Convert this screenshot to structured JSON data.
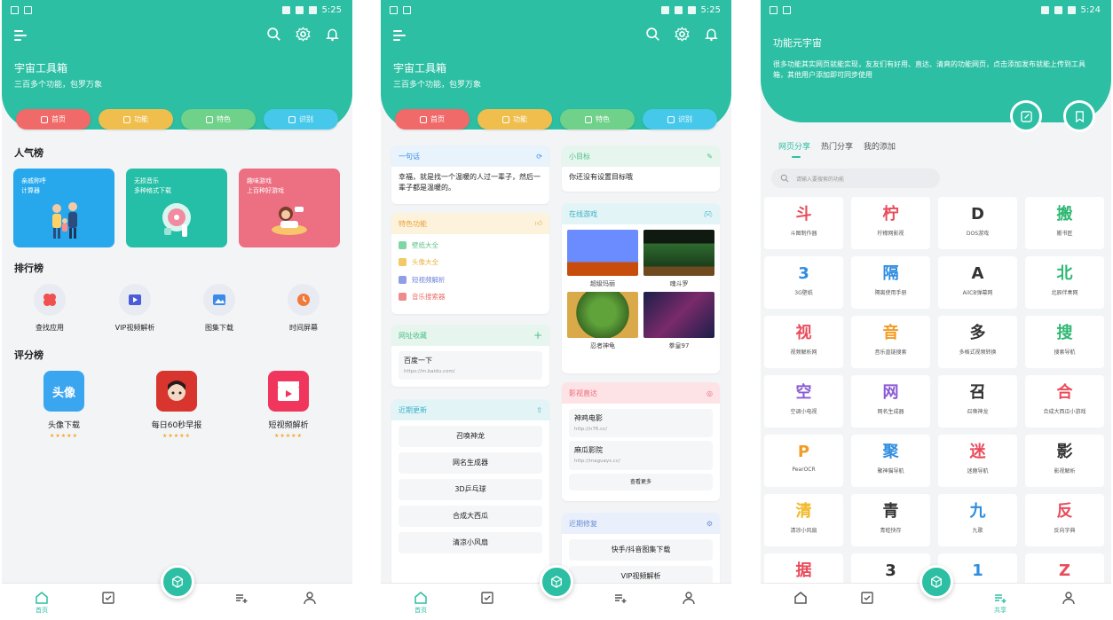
{
  "status_times": [
    "5:25",
    "5:25",
    "5:24"
  ],
  "header": {
    "title": "宇宙工具箱",
    "subtitle": "三百多个功能，包罗万象"
  },
  "pills": [
    "首页",
    "功能",
    "特色",
    "识别"
  ],
  "screen1": {
    "popular_title": "人气榜",
    "banners": [
      {
        "line1": "亲戚称呼",
        "line2": "计算器",
        "color": "#27a8ec"
      },
      {
        "line1": "无损音乐",
        "line2": "多种格式下载",
        "color": "#24bfa6"
      },
      {
        "line1": "趣味游戏",
        "line2": "上百种好游戏",
        "color": "#ec6f82"
      }
    ],
    "ranking_title": "排行榜",
    "ranking": [
      "查找应用",
      "VIP视频解析",
      "图集下载",
      "时间屏幕"
    ],
    "score_title": "评分榜",
    "scores": [
      {
        "label": "头像下载",
        "icon_text": "头像",
        "stars": "★★★★★"
      },
      {
        "label": "每日60秒早报",
        "icon_text": "",
        "stars": "★★★★★"
      },
      {
        "label": "短视频解析",
        "icon_text": "",
        "stars": "★★★★★"
      }
    ]
  },
  "screen2": {
    "quote": {
      "title": "一句话",
      "text": "幸福，就是找一个温暖的人过一辈子，然后一辈子都是温暖的。"
    },
    "goal": {
      "title": "小目标",
      "text": "你还没有设置目标哦"
    },
    "features": {
      "title": "特色功能",
      "items": [
        "壁纸大全",
        "头像大全",
        "短视频解析",
        "音乐搜索器"
      ]
    },
    "games": {
      "title": "在线游戏",
      "items": [
        "超级玛丽",
        "魂斗罗",
        "忍者神龟",
        "拳皇97"
      ]
    },
    "bookmarks": {
      "title": "网址收藏",
      "name": "百度一下",
      "url": "https://m.baidu.com/"
    },
    "movies": {
      "title": "影视直达",
      "items": [
        {
          "name": "神鸡电影",
          "url": "http://n76.cc/"
        },
        {
          "name": "麻瓜影院",
          "url": "http://maguays.cc/"
        }
      ],
      "more": "查看更多"
    },
    "recent_updates": {
      "title": "近期更新",
      "items": [
        "召唤神龙",
        "网名生成器",
        "3D乒乓球",
        "合成大西瓜",
        "清凉小风扇"
      ]
    },
    "recent_fixes": {
      "title": "近期修复",
      "items": [
        "快手/抖音图集下载",
        "VIP视频解析"
      ]
    }
  },
  "screen3": {
    "title": "功能元宇宙",
    "desc": "很多功能其实网页就能实现，友友们有好用、直达、清爽的功能网页，点击添加发布就能上传到工具箱，其他用户添加即可同步使用",
    "tabs": [
      "网页分享",
      "热门分享",
      "我的添加"
    ],
    "search_placeholder": "请输入要搜索的功能",
    "tools": [
      {
        "ch": "斗",
        "name": "斗图制作器",
        "color": "#e94b5a"
      },
      {
        "ch": "柠",
        "name": "柠檬网影视",
        "color": "#e94b5a"
      },
      {
        "ch": "D",
        "name": "DOS游戏",
        "color": "#333333"
      },
      {
        "ch": "搬",
        "name": "搬书匠",
        "color": "#2fb873"
      },
      {
        "ch": "3",
        "name": "3G壁纸",
        "color": "#2f8de0"
      },
      {
        "ch": "隔",
        "name": "隔离使用手册",
        "color": "#2f8de0"
      },
      {
        "ch": "A",
        "name": "AilCB弹幕网",
        "color": "#333333"
      },
      {
        "ch": "北",
        "name": "北辰伴奏网",
        "color": "#2fb873"
      },
      {
        "ch": "视",
        "name": "视频解析网",
        "color": "#e94b5a"
      },
      {
        "ch": "音",
        "name": "音乐直链搜索",
        "color": "#f29c24"
      },
      {
        "ch": "多",
        "name": "多格式视频转换",
        "color": "#333333"
      },
      {
        "ch": "搜",
        "name": "搜索导航",
        "color": "#2fb873"
      },
      {
        "ch": "空",
        "name": "空调小电视",
        "color": "#8a5bd4"
      },
      {
        "ch": "网",
        "name": "网名生成器",
        "color": "#8a5bd4"
      },
      {
        "ch": "召",
        "name": "召唤神龙",
        "color": "#333333"
      },
      {
        "ch": "合",
        "name": "合成大西瓜小游戏",
        "color": "#e94b5a"
      },
      {
        "ch": "P",
        "name": "PearOCR",
        "color": "#f29c24"
      },
      {
        "ch": "聚",
        "name": "聚神猫导航",
        "color": "#2f8de0"
      },
      {
        "ch": "迷",
        "name": "迷鹿导航",
        "color": "#e94b5a"
      },
      {
        "ch": "影",
        "name": "影视解析",
        "color": "#333333"
      },
      {
        "ch": "清",
        "name": "清凉小风扇",
        "color": "#f2b824"
      },
      {
        "ch": "青",
        "name": "青蛙快存",
        "color": "#333333"
      },
      {
        "ch": "九",
        "name": "九歌",
        "color": "#2f8de0"
      },
      {
        "ch": "反",
        "name": "反向字典",
        "color": "#e94b5a"
      },
      {
        "ch": "据",
        "name": "",
        "color": "#e94b5a"
      },
      {
        "ch": "3",
        "name": "",
        "color": "#333333"
      },
      {
        "ch": "1",
        "name": "",
        "color": "#2f8de0"
      },
      {
        "ch": "Z",
        "name": "",
        "color": "#e94b5a"
      }
    ]
  },
  "nav": {
    "home": "首页",
    "share": "共享"
  },
  "colors": {
    "primary": "#2cbfa3"
  }
}
